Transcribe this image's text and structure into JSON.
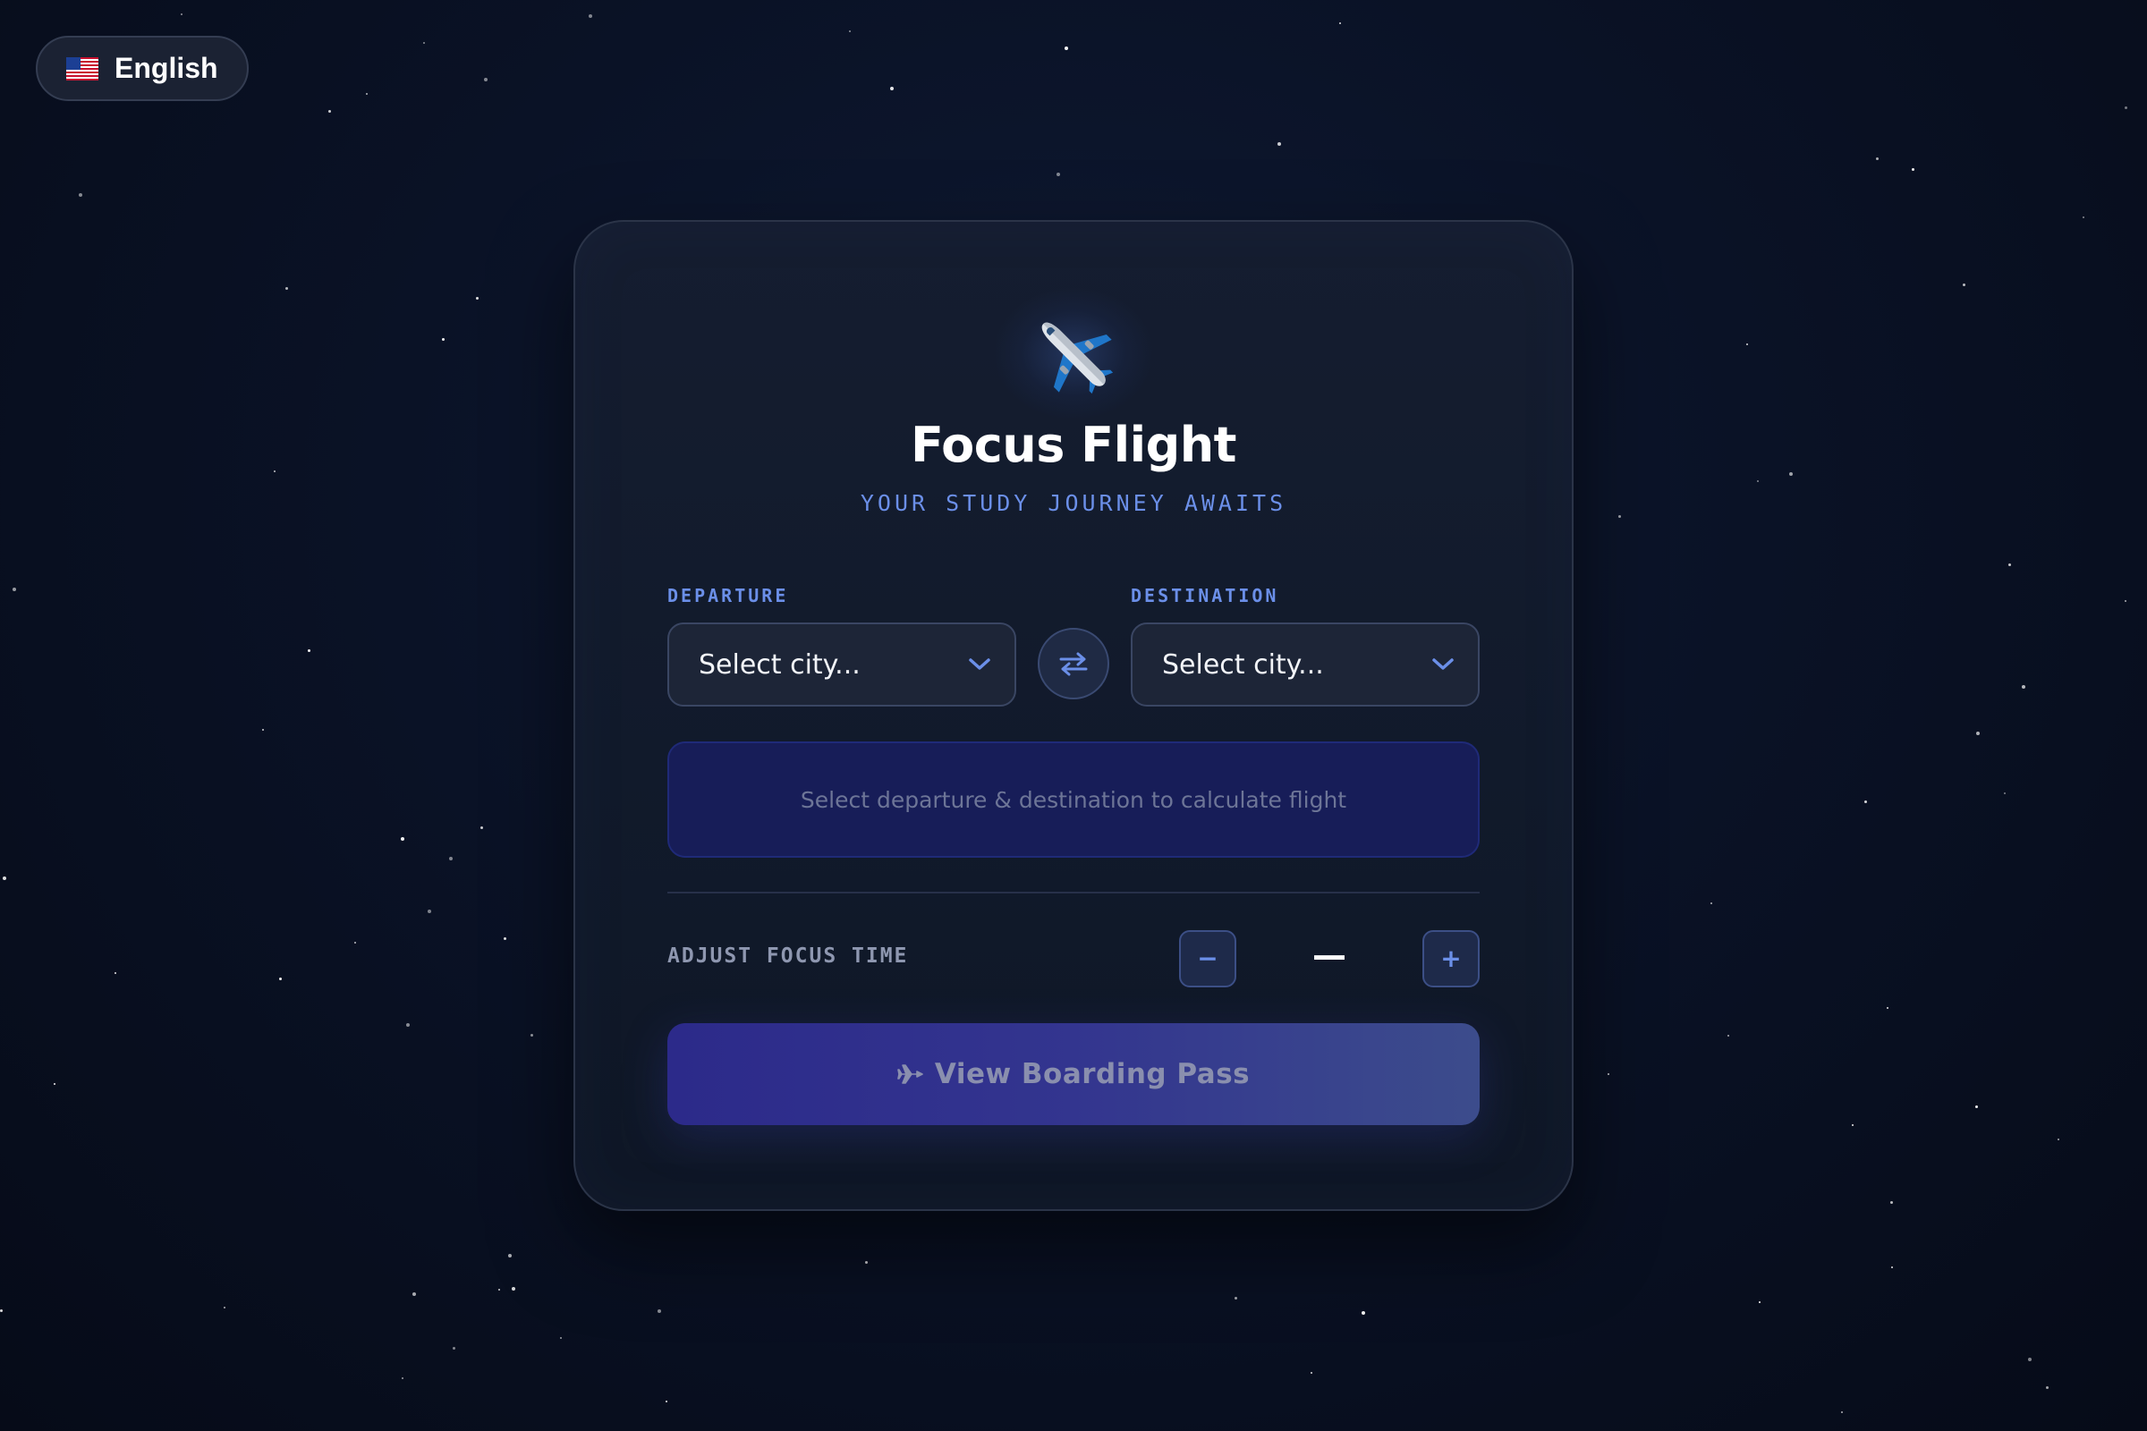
{
  "language": {
    "flag_icon": "us-flag-icon",
    "label": "English"
  },
  "header": {
    "logo_icon": "airplane-icon",
    "title": "Focus Flight",
    "subtitle": "YOUR STUDY JOURNEY AWAITS"
  },
  "route": {
    "departure": {
      "label": "DEPARTURE",
      "selected": "Select city..."
    },
    "destination": {
      "label": "DESTINATION",
      "selected": "Select city..."
    },
    "swap_icon": "swap-arrows-icon"
  },
  "flight_info": {
    "message": "Select departure & destination to calculate flight"
  },
  "focus_time": {
    "label": "ADJUST FOCUS TIME",
    "decrement_label": "−",
    "increment_label": "+",
    "value": "—"
  },
  "boarding_button": {
    "icon": "airplane-icon",
    "label": "View Boarding Pass"
  },
  "colors": {
    "background": "#0a1226",
    "card": "#151d30",
    "accent": "#6b8fe8",
    "info_box": "#171d58",
    "button_start": "#2c2a8a",
    "button_end": "#3c4c8c"
  }
}
